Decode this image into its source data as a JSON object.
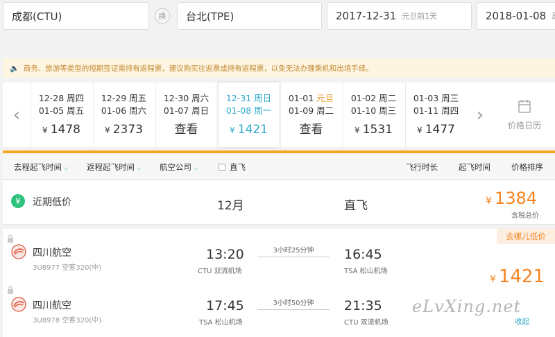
{
  "search": {
    "from": "成都(CTU)",
    "swap_label": "换",
    "to": "台北(TPE)",
    "depart_date": "2017-12-31",
    "depart_note": "元旦前1天",
    "return_date": "2018-01-08",
    "return_note": "周一"
  },
  "notice": "商务、旅游等类型的短期签证需持有返程票，建议购买往返票或持有返程票，以免无法办理乘机和出境手续。",
  "date_strip": {
    "cells": [
      {
        "l1": "12-28 周四",
        "l2": "01-05 周五",
        "price": "1478",
        "view": ""
      },
      {
        "l1": "12-29 周五",
        "l2": "01-06 周六",
        "price": "2373",
        "view": ""
      },
      {
        "l1": "12-30 周六",
        "l2": "01-07 周日",
        "price": "",
        "view": "查看"
      },
      {
        "l1": "12-31 周日",
        "l2": "01-08 周一",
        "price": "1421",
        "view": ""
      },
      {
        "l1_date": "01-01",
        "l1_holiday": "元旦",
        "l2": "01-09 周二",
        "price": "",
        "view": "查看"
      },
      {
        "l1": "01-02 周二",
        "l2": "01-10 周三",
        "price": "1531",
        "view": ""
      },
      {
        "l1": "01-03 周三",
        "l2": "01-11 周四",
        "price": "1477",
        "view": ""
      }
    ],
    "currency": "¥",
    "calendar_label": "价格日历"
  },
  "filters": {
    "depart_time": "去程起飞时间",
    "return_time": "返程起飞时间",
    "airline": "航空公司",
    "direct": "直飞",
    "sort_duration": "飞行时长",
    "sort_depart": "起飞时间",
    "sort_price": "价格排序"
  },
  "lowest": {
    "label": "近期低价",
    "month": "12月",
    "type": "直飞",
    "currency": "¥",
    "price": "1384",
    "note": "含税总价"
  },
  "flight": {
    "badge": "去哪儿低价",
    "currency": "¥",
    "price": "1421",
    "collapse": "收起",
    "legs": [
      {
        "airline": "四川航空",
        "flight": "3U8977 空客320(中)",
        "dep_time": "13:20",
        "dep_airport": "CTU 双流机场",
        "duration": "3小时25分钟",
        "arr_time": "16:45",
        "arr_airport": "TSA 松山机场"
      },
      {
        "airline": "四川航空",
        "flight": "3U8978 空客320(中)",
        "dep_time": "17:45",
        "dep_airport": "TSA 松山机场",
        "duration": "3小时50分钟",
        "arr_time": "21:35",
        "arr_airport": "CTU 双流机场"
      }
    ]
  },
  "watermark": "eLvXing.net",
  "colors": {
    "accent": "#2aa8c8",
    "price": "#f5841f",
    "line": "#f5a623"
  }
}
